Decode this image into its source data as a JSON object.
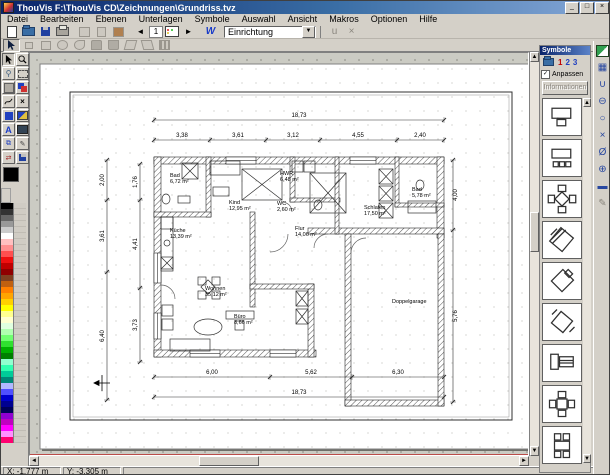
{
  "window": {
    "title": "ThouVis   F:\\ThouVis CD\\Zeichnungen\\Grundriss.tvz",
    "controls": {
      "minimize": "_",
      "maximize": "□",
      "close": "×"
    }
  },
  "menus": [
    "Datei",
    "Bearbeiten",
    "Ebenen",
    "Unterlagen",
    "Symbole",
    "Auswahl",
    "Ansicht",
    "Makros",
    "Optionen",
    "Hilfe"
  ],
  "toolbar": {
    "page_number": "1",
    "prev_glyph": "◄",
    "next_glyph": "►",
    "w_label": "W",
    "view_combo_value": "Einrichtung",
    "icons_file": [
      "new-icon",
      "open-icon",
      "save-icon",
      "print-icon"
    ],
    "icons_edit": [
      "cut-icon",
      "copy-icon",
      "paste-icon"
    ],
    "icons_extra": [
      "undo-icon",
      "delete-icon"
    ]
  },
  "statusbar": {
    "x": "X: -1,777 m",
    "y": "Y: -3,305 m"
  },
  "symbols_panel": {
    "title": "Symbole",
    "open_icon": "open-symbols-icon",
    "numbers": [
      "1",
      "2",
      "3"
    ],
    "checkbox_label": "Anpassen",
    "checkbox_checked": "✓",
    "info_button": "Informationen",
    "items": [
      "desk-chair",
      "desk-drawers",
      "table-diamond",
      "bed-hatch",
      "bed-diamond",
      "bed-pencil",
      "shelf-desk",
      "table-cross",
      "table-rect-chairs"
    ]
  },
  "right_toolbar_icons": [
    "window-icon",
    "grid-icon",
    "magnet-icon",
    "snap-node-icon",
    "snap-circle-icon",
    "snap-cross-icon",
    "no-snap-icon",
    "snap-center-icon",
    "image-icon",
    "draw-icon"
  ],
  "plan": {
    "rooms": [
      {
        "name": "Bad",
        "area": "6,72 m²"
      },
      {
        "name": "Kind",
        "area": "12,95 m²"
      },
      {
        "name": "HWR",
        "area": "6,48 m²"
      },
      {
        "name": "WC",
        "area": "2,60 m²"
      },
      {
        "name": "Schlafen",
        "area": "17,50 m²"
      },
      {
        "name": "Bad",
        "area": "5,78 m²"
      },
      {
        "name": "Küche",
        "area": "13,39 m²"
      },
      {
        "name": "Flur",
        "area": "14,06 m²"
      },
      {
        "name": "Wohnen",
        "area": "35,12 m²"
      },
      {
        "name": "Büro",
        "area": "8,66 m²"
      },
      {
        "name": "Doppelgarage",
        "area": ""
      }
    ],
    "dim_top_total": "18,73",
    "dims_top": [
      "3,38",
      "3,61",
      "3,12",
      "4,55",
      "2,40"
    ],
    "dims_bottom": [
      "6,00",
      "5,62",
      "6,30"
    ],
    "dim_bottom_total": "18,73",
    "dims_left_outer": [
      "2,00",
      "3,61",
      "6,40"
    ],
    "dims_left_inner": [
      "1,76",
      "4,41",
      "3,73"
    ],
    "dims_right": [
      "4,00",
      "5,76"
    ]
  },
  "colors": [
    "#000000",
    "#333333",
    "#666666",
    "#999999",
    "#cccccc",
    "#ffffff",
    "#ffc0c0",
    "#ff9090",
    "#ff5050",
    "#ee1010",
    "#c00000",
    "#900000",
    "#804020",
    "#c06010",
    "#ff8000",
    "#ffa500",
    "#ffd000",
    "#ffff00",
    "#ffff90",
    "#ffffd0",
    "#e0ffe0",
    "#b0ffb0",
    "#70ff70",
    "#30e030",
    "#00b000",
    "#008000",
    "#90ffd0",
    "#30ffb0",
    "#00cc99",
    "#008878",
    "#b0b8ff",
    "#5050ff",
    "#0000cc",
    "#000090",
    "#000058",
    "#9000d0",
    "#c000c0",
    "#ff00ff",
    "#ff90ff",
    "#ff0070"
  ],
  "scroll_glyphs": {
    "left": "◄",
    "right": "►",
    "up": "▲",
    "down": "▼"
  }
}
